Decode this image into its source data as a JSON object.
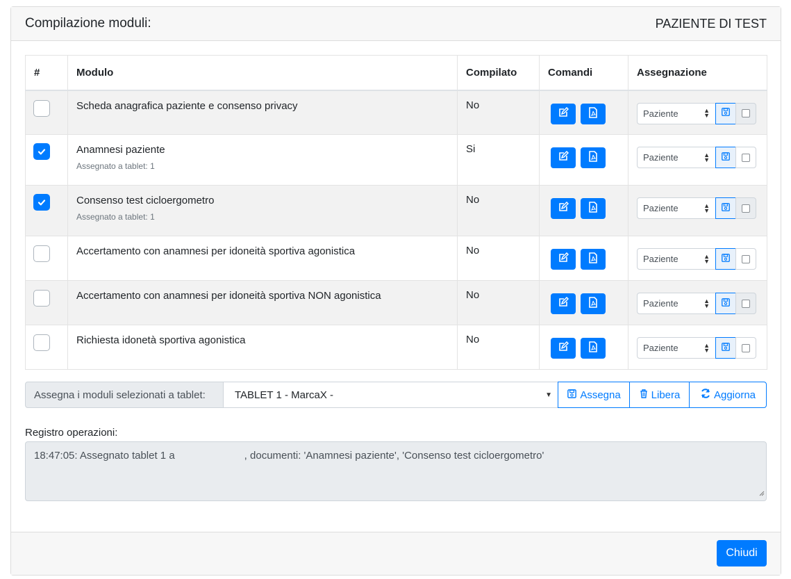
{
  "header": {
    "title": "Compilazione moduli:",
    "patient": "PAZIENTE DI TEST"
  },
  "table": {
    "headers": {
      "num": "#",
      "module": "Modulo",
      "completed": "Compilato",
      "commands": "Comandi",
      "assignment": "Assegnazione"
    },
    "rows": [
      {
        "checked": false,
        "module": "Scheda anagrafica paziente e consenso privacy",
        "sub": "",
        "completed": "No",
        "assign": "Paziente"
      },
      {
        "checked": true,
        "module": "Anamnesi paziente",
        "sub": "Assegnato a tablet: 1",
        "completed": "Si",
        "assign": "Paziente"
      },
      {
        "checked": true,
        "module": "Consenso test cicloergometro",
        "sub": "Assegnato a tablet: 1",
        "completed": "No",
        "assign": "Paziente"
      },
      {
        "checked": false,
        "module": "Accertamento con anamnesi per idoneità sportiva agonistica",
        "sub": "",
        "completed": "No",
        "assign": "Paziente"
      },
      {
        "checked": false,
        "module": "Accertamento con anamnesi per idoneità sportiva NON agonistica",
        "sub": "",
        "completed": "No",
        "assign": "Paziente"
      },
      {
        "checked": false,
        "module": "Richiesta idonetà sportiva agonistica",
        "sub": "",
        "completed": "No",
        "assign": "Paziente"
      }
    ]
  },
  "tablet_bar": {
    "label": "Assegna i moduli selezionati a tablet:",
    "selected": "TABLET 1 - MarcaX -",
    "assign_label": "Assegna",
    "free_label": "Libera",
    "refresh_label": "Aggiorna"
  },
  "log": {
    "label": "Registro operazioni:",
    "text": "18:47:05: Assegnato tablet 1 a                        , documenti: 'Anamnesi paziente', 'Consenso test cicloergometro'"
  },
  "footer": {
    "close_label": "Chiudi"
  },
  "colors": {
    "primary": "#007bff",
    "header_bg": "#f7f7f7"
  },
  "icons": {
    "edit": "edit-icon",
    "pdf": "pdf-icon",
    "save": "floppy-icon",
    "trash": "trash-icon",
    "refresh": "refresh-icon"
  }
}
